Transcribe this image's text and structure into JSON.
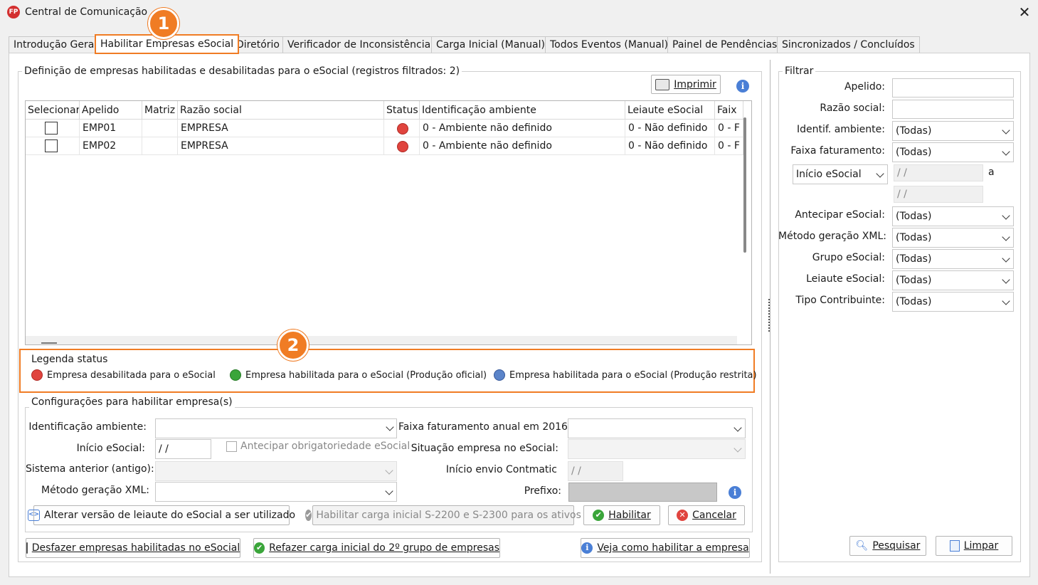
{
  "window": {
    "title": "Central de Comunicação",
    "icon": "FP"
  },
  "tabs": [
    "Introdução Geral",
    "Habilitar Empresas eSocial",
    "Diretório",
    "Verificador de Inconsistências",
    "Carga Inicial (Manual)",
    "Todos Eventos (Manual)",
    "Painel de Pendências",
    "Sincronizados / Concluídos"
  ],
  "badges": [
    "1",
    "2"
  ],
  "definicao": {
    "title": "Definição de empresas habilitadas e desabilitadas para o eSocial (registros filtrados: 2)",
    "print_button": "Imprimir",
    "columns": [
      "Selecionar",
      "Apelido",
      "Matriz",
      "Razão social",
      "Status",
      "Identificação ambiente",
      "Leiaute eSocial",
      "Faix"
    ],
    "rows": [
      {
        "apelido": "EMP01",
        "matriz": "",
        "razao": "EMPRESA",
        "status": "red",
        "ambiente": "0 - Ambiente não definido",
        "leiaute": "0 - Não definido",
        "faixa": "0 - F"
      },
      {
        "apelido": "EMP02",
        "matriz": "",
        "razao": "EMPRESA",
        "status": "red",
        "ambiente": "0 - Ambiente não definido",
        "leiaute": "0 - Não definido",
        "faixa": "0 - F"
      }
    ]
  },
  "legenda": {
    "title": "Legenda status",
    "items": [
      {
        "label": "Empresa desabilitada para o eSocial",
        "color": "#e0443e"
      },
      {
        "label": "Empresa habilitada para o eSocial (Produção oficial)",
        "color": "#3aa53a"
      },
      {
        "label": "Empresa habilitada para o eSocial (Produção restrita)",
        "color": "#5b84c9"
      }
    ]
  },
  "config": {
    "title": "Configurações para habilitar empresa(s)",
    "identificacao_label": "Identificação ambiente:",
    "identificacao_value": "",
    "inicio_label": "Início eSocial:",
    "inicio_value": "/ /",
    "antecipar_label": "Antecipar obrigatoriedade eSocial",
    "sistema_label": "Sistema anterior (antigo):",
    "metodo_label": "Método geração XML:",
    "faixa_label": "Faixa faturamento anual em 2016:",
    "situacao_label": "Situação empresa no eSocial:",
    "contmatic_label": "Início envio Contmatic",
    "contmatic_value": "/ /",
    "prefixo_label": "Prefixo:",
    "alterar_button": "Alterar versão de leiaute do eSocial a ser utilizado",
    "carga_button": "Habilitar carga inicial S-2200 e S-2300 para os ativos",
    "habilitar_button": "Habilitar",
    "cancelar_button": "Cancelar"
  },
  "bottom": {
    "desfazer_button": "Desfazer empresas habilitadas no eSocial",
    "refazer_button": "Refazer carga inicial do 2º grupo de empresas",
    "veja_button": "Veja como habilitar a empresa"
  },
  "filtrar": {
    "title": "Filtrar",
    "apelido_label": "Apelido:",
    "razao_label": "Razão social:",
    "ambiente_label": "Identif. ambiente:",
    "ambiente_value": "(Todas)",
    "faixa_label": "Faixa faturamento:",
    "faixa_value": "(Todas)",
    "inicio_select": "Início eSocial",
    "date_from": "/ /",
    "date_to": "/ /",
    "a_label": "a",
    "antecipar_label": "Antecipar eSocial:",
    "antecipar_value": "(Todas)",
    "metodo_label": "Método geração XML:",
    "metodo_value": "(Todas)",
    "grupo_label": "Grupo eSocial:",
    "grupo_value": "(Todas)",
    "leiaute_label": "Leiaute eSocial:",
    "leiaute_value": "(Todas)",
    "tipo_label": "Tipo Contribuinte:",
    "tipo_value": "(Todas)",
    "pesquisar_button": "Pesquisar",
    "limpar_button": "Limpar"
  },
  "colors": {
    "accent": "#f07c24",
    "info": "#4a7fd6"
  }
}
